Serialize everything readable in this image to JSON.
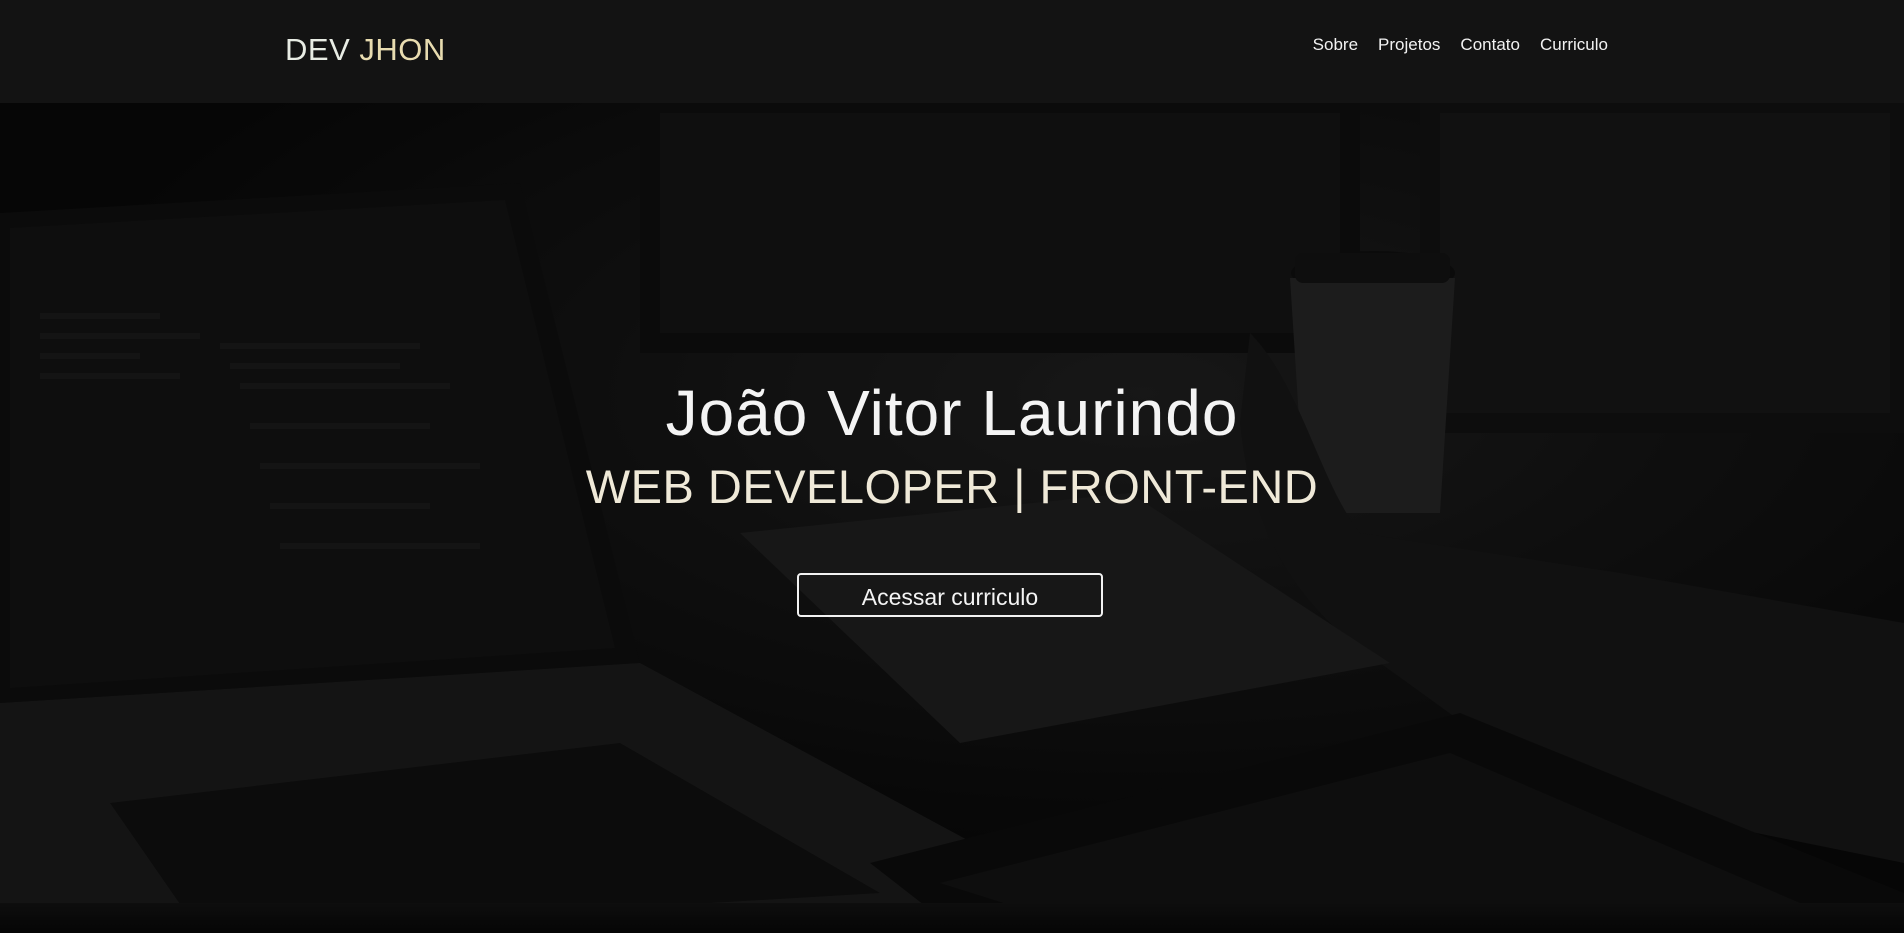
{
  "header": {
    "logo_first": "DEV",
    "logo_second": "JHON",
    "nav": [
      {
        "label": "Sobre"
      },
      {
        "label": "Projetos"
      },
      {
        "label": "Contato"
      },
      {
        "label": "Curriculo"
      }
    ]
  },
  "hero": {
    "title": "João Vitor Laurindo",
    "subtitle": "WEB DEVELOPER | FRONT-END",
    "button_label": "Acessar curriculo"
  },
  "colors": {
    "header_bg": "#131313",
    "text": "#f4f4f4",
    "accent": "#efe9d8"
  }
}
